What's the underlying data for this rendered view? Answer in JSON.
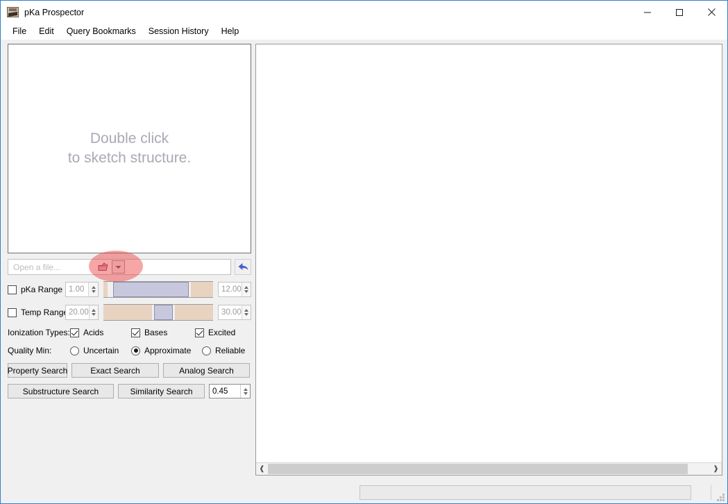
{
  "window": {
    "title": "pKa Prospector",
    "app_icon": "pka-app-icon",
    "controls": {
      "minimize": "minimize-icon",
      "maximize": "maximize-icon",
      "close": "close-icon"
    },
    "accent_border": "#2f7fd1"
  },
  "menubar": {
    "items": [
      {
        "label": "File"
      },
      {
        "label": "Edit"
      },
      {
        "label": "Query Bookmarks"
      },
      {
        "label": "Session History"
      },
      {
        "label": "Help"
      }
    ]
  },
  "sketch": {
    "placeholder": "Double click\nto sketch structure."
  },
  "file_row": {
    "placeholder": "Open a file...",
    "value": "",
    "open_icon": "folder-open-icon",
    "dropdown_icon": "chevron-down-icon",
    "back_icon": "back-arrow-icon",
    "highlight_color": "#ec4646"
  },
  "ranges": [
    {
      "id": "pka",
      "label": "pKa Range",
      "checked": false,
      "enabled": false,
      "min_value": "1.00",
      "max_value": "12.00",
      "slider": {
        "lead": 4,
        "handle_start": 9,
        "handle_end": 78,
        "trail": 100
      }
    },
    {
      "id": "temp",
      "label": "Temp Range",
      "checked": false,
      "enabled": false,
      "min_value": "20.00",
      "max_value": "30.00",
      "slider": {
        "lead": 0,
        "handle_start": 45,
        "handle_end": 63,
        "trail": 100
      }
    }
  ],
  "ionization": {
    "title": "Ionization Types:",
    "options": [
      {
        "label": "Acids",
        "checked": true
      },
      {
        "label": "Bases",
        "checked": true
      },
      {
        "label": "Excited",
        "checked": true
      }
    ]
  },
  "quality": {
    "title": "Quality Min:",
    "options": [
      {
        "label": "Uncertain",
        "selected": false
      },
      {
        "label": "Approximate",
        "selected": true
      },
      {
        "label": "Reliable",
        "selected": false
      }
    ]
  },
  "search_buttons": {
    "row1": [
      {
        "label": "Property Search"
      },
      {
        "label": "Exact Search"
      },
      {
        "label": "Analog Search"
      }
    ],
    "row2": [
      {
        "label": "Substructure Search"
      },
      {
        "label": "Similarity Search"
      }
    ],
    "similarity_threshold": "0.45"
  },
  "results_panel": {
    "content": "",
    "scroll_left_icon": "chevron-left-icon",
    "scroll_right_icon": "chevron-right-icon"
  },
  "statusbar": {
    "message": "",
    "grip": "resize-grip-icon"
  }
}
